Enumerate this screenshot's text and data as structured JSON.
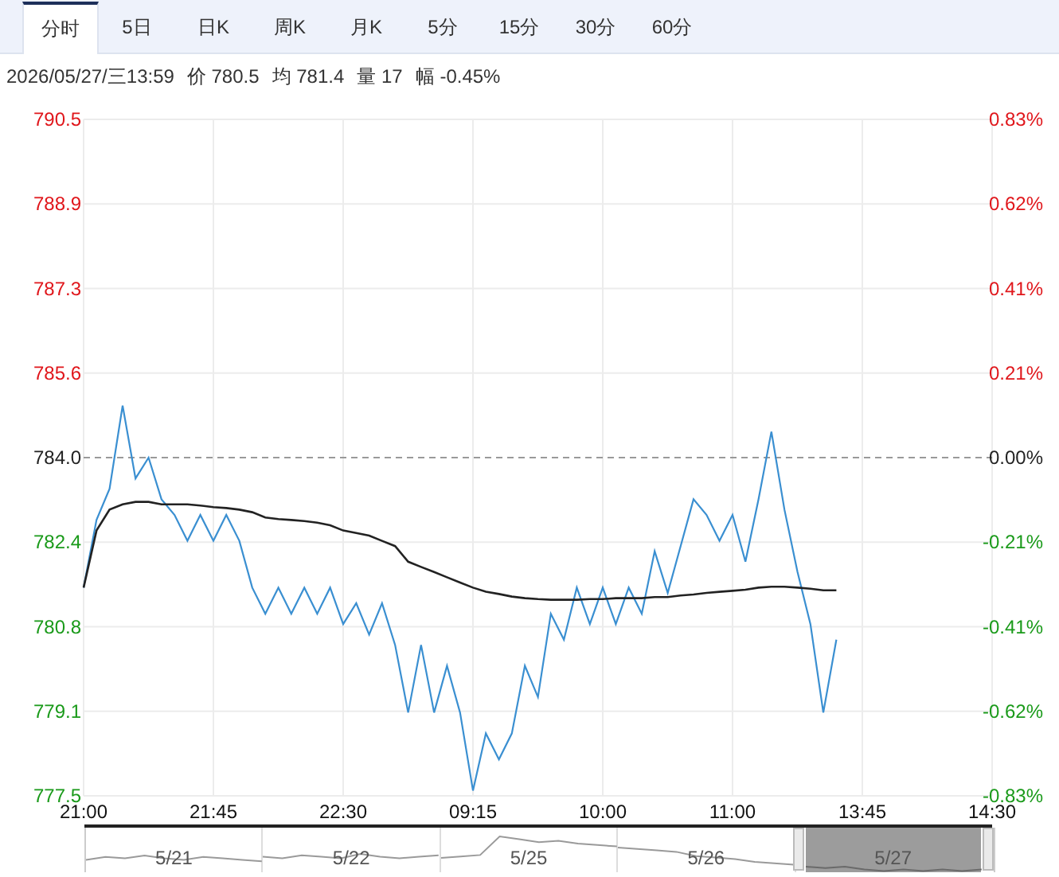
{
  "tabs": [
    {
      "label": "分时",
      "selected": true
    },
    {
      "label": "5日",
      "selected": false
    },
    {
      "label": "日K",
      "selected": false
    },
    {
      "label": "周K",
      "selected": false
    },
    {
      "label": "月K",
      "selected": false
    },
    {
      "label": "5分",
      "selected": false
    },
    {
      "label": "15分",
      "selected": false
    },
    {
      "label": "30分",
      "selected": false
    },
    {
      "label": "60分",
      "selected": false
    }
  ],
  "info": [
    "2026/05/27/三13:59",
    "价 780.5",
    "均 781.4",
    "量 17",
    "幅 -0.45%"
  ],
  "chart": {
    "chart_data": {
      "type": "line",
      "categories": [
        "21:00",
        null,
        null,
        null,
        null,
        null,
        null,
        null,
        null,
        null,
        "21:45",
        null,
        null,
        null,
        null,
        null,
        null,
        null,
        null,
        null,
        "22:30",
        null,
        null,
        null,
        null,
        null,
        null,
        null,
        null,
        null,
        "09:15",
        null,
        null,
        null,
        null,
        null,
        null,
        null,
        null,
        null,
        "10:00",
        null,
        null,
        null,
        null,
        null,
        null,
        null,
        null,
        null,
        "11:00",
        null,
        null,
        null,
        null,
        null,
        null,
        null,
        null,
        null,
        "13:45",
        null,
        null,
        null,
        null,
        null,
        null,
        null,
        null,
        null,
        "14:30"
      ],
      "series": [
        {
          "color": "#3a8fd1",
          "values": [
            781.5,
            782.8,
            783.4,
            785.0,
            783.6,
            784.0,
            783.2,
            782.9,
            782.4,
            782.9,
            782.4,
            782.9,
            782.4,
            781.5,
            781.0,
            781.5,
            781.0,
            781.5,
            781.0,
            781.5,
            780.8,
            781.2,
            780.6,
            781.2,
            780.4,
            779.1,
            780.4,
            779.1,
            780.0,
            779.1,
            777.6,
            778.7,
            778.2,
            778.7,
            780.0,
            779.4,
            781.0,
            780.5,
            781.5,
            780.8,
            781.5,
            780.8,
            781.5,
            781.0,
            782.2,
            781.4,
            782.3,
            783.2,
            782.9,
            782.4,
            782.9,
            782.0,
            783.2,
            784.5,
            783.0,
            781.8,
            780.8,
            779.1,
            780.5,
            null,
            null,
            null,
            null,
            null,
            null,
            null,
            null,
            null,
            null,
            null,
            null
          ]
        },
        {
          "color": "#222222",
          "values": [
            781.5,
            782.6,
            783.0,
            783.1,
            783.15,
            783.15,
            783.1,
            783.1,
            783.1,
            783.08,
            783.05,
            783.03,
            783.0,
            782.95,
            782.85,
            782.82,
            782.8,
            782.78,
            782.75,
            782.7,
            782.6,
            782.55,
            782.5,
            782.4,
            782.3,
            782.0,
            781.9,
            781.8,
            781.7,
            781.6,
            781.5,
            781.42,
            781.38,
            781.33,
            781.3,
            781.28,
            781.27,
            781.27,
            781.27,
            781.28,
            781.28,
            781.3,
            781.3,
            781.3,
            781.32,
            781.32,
            781.35,
            781.37,
            781.4,
            781.42,
            781.44,
            781.46,
            781.5,
            781.52,
            781.52,
            781.5,
            781.48,
            781.45,
            781.45,
            null,
            null,
            null,
            null,
            null,
            null,
            null,
            null,
            null,
            null,
            null,
            null
          ]
        }
      ],
      "ylim": [
        777.5,
        790.5
      ],
      "yticks": [
        {
          "value": 790.5,
          "label": "790.5"
        },
        {
          "value": 788.875,
          "label": "788.9"
        },
        {
          "value": 787.25,
          "label": "787.3"
        },
        {
          "value": 785.625,
          "label": "785.6"
        },
        {
          "value": 784.0,
          "label": "784.0"
        },
        {
          "value": 782.375,
          "label": "782.4"
        },
        {
          "value": 780.75,
          "label": "780.8"
        },
        {
          "value": 779.125,
          "label": "779.1"
        },
        {
          "value": 777.5,
          "label": "777.5"
        }
      ],
      "y2lim": [
        -0.829,
        0.829
      ],
      "y2ticks": [
        {
          "value": 0.829,
          "label": "0.83%"
        },
        {
          "value": 0.622,
          "label": "0.62%"
        },
        {
          "value": 0.4145,
          "label": "0.41%"
        },
        {
          "value": 0.2073,
          "label": "0.21%"
        },
        {
          "value": 0,
          "label": "0.00%"
        },
        {
          "value": -0.2073,
          "label": "-0.21%"
        },
        {
          "value": -0.4145,
          "label": "-0.41%"
        },
        {
          "value": -0.622,
          "label": "-0.62%"
        },
        {
          "value": -0.829,
          "label": "-0.83%"
        }
      ],
      "grid": true,
      "ref_lines": [
        {
          "axis": "y",
          "value": 784.0
        }
      ]
    }
  },
  "navigator": {
    "days": [
      {
        "label": "5/21",
        "selected": false
      },
      {
        "label": "5/22",
        "selected": false
      },
      {
        "label": "5/25",
        "selected": false
      },
      {
        "label": "5/26",
        "selected": false
      },
      {
        "label": "5/27",
        "selected": true
      }
    ]
  }
}
